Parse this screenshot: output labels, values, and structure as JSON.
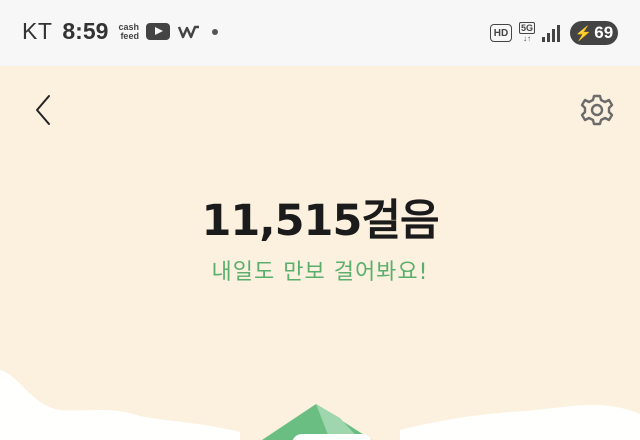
{
  "status_bar": {
    "carrier": "KT",
    "time": "8:59",
    "cashfeed_line1": "cash",
    "cashfeed_line2": "feed",
    "hd_label": "HD",
    "network_label": "5G",
    "battery_level": "69",
    "icons": [
      "youtube-icon",
      "wavve-icon",
      "notification-dot-icon",
      "hd-icon",
      "5g-icon",
      "signal-icon",
      "charging-icon"
    ]
  },
  "header": {
    "back_icon": "chevron-left-icon",
    "settings_icon": "gear-icon"
  },
  "main": {
    "step_count": "11,515걸음",
    "message": "내일도 만보 걸어봐요!"
  },
  "colors": {
    "background": "#FCF1DF",
    "status_bar": "#F7F7F7",
    "accent_green": "#5BAF6E"
  }
}
